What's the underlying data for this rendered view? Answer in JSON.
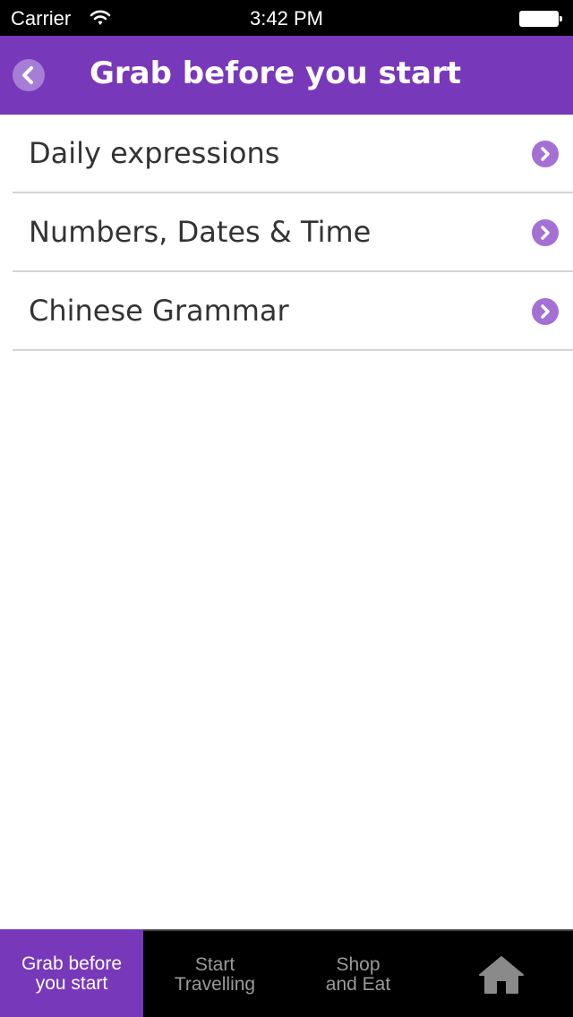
{
  "status_bar": {
    "carrier": "Carrier",
    "time": "3:42 PM",
    "wifi_icon": "wifi-icon",
    "battery_icon": "battery-icon"
  },
  "nav": {
    "title": "Grab before you start",
    "back_icon": "chevron-left-icon"
  },
  "list": {
    "items": [
      {
        "label": "Daily expressions",
        "icon": "chevron-right-icon"
      },
      {
        "label": "Numbers, Dates & Time",
        "icon": "chevron-right-icon"
      },
      {
        "label": "Chinese Grammar",
        "icon": "chevron-right-icon"
      }
    ]
  },
  "tab_bar": {
    "tabs": [
      {
        "label": "Grab before\nyou start",
        "active": true
      },
      {
        "label": "Start\nTravelling",
        "active": false
      },
      {
        "label": "Shop\nand Eat",
        "active": false
      },
      {
        "label": "",
        "icon": "home-icon",
        "active": false
      }
    ]
  },
  "colors": {
    "accent": "#7838BA",
    "chevron": "#A470D4",
    "tab_inactive_text": "#9a9a9a"
  }
}
